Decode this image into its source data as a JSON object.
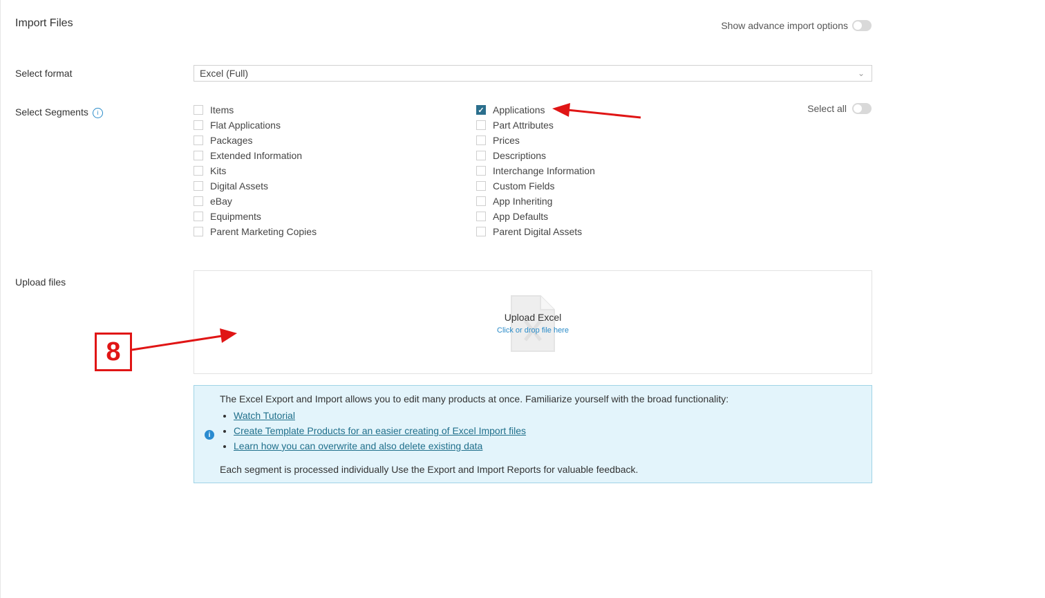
{
  "header": {
    "title": "Import Files",
    "advanced_label": "Show advance import options"
  },
  "format": {
    "label": "Select format",
    "value": "Excel (Full)"
  },
  "segments": {
    "label": "Select Segments",
    "select_all_label": "Select all",
    "left": [
      {
        "label": "Items",
        "checked": false
      },
      {
        "label": "Flat Applications",
        "checked": false
      },
      {
        "label": "Packages",
        "checked": false
      },
      {
        "label": "Extended Information",
        "checked": false
      },
      {
        "label": "Kits",
        "checked": false
      },
      {
        "label": "Digital Assets",
        "checked": false
      },
      {
        "label": "eBay",
        "checked": false
      },
      {
        "label": "Equipments",
        "checked": false
      },
      {
        "label": "Parent Marketing Copies",
        "checked": false
      }
    ],
    "right": [
      {
        "label": "Applications",
        "checked": true
      },
      {
        "label": "Part Attributes",
        "checked": false
      },
      {
        "label": "Prices",
        "checked": false
      },
      {
        "label": "Descriptions",
        "checked": false
      },
      {
        "label": "Interchange Information",
        "checked": false
      },
      {
        "label": "Custom Fields",
        "checked": false
      },
      {
        "label": "App Inheriting",
        "checked": false
      },
      {
        "label": "App Defaults",
        "checked": false
      },
      {
        "label": "Parent Digital Assets",
        "checked": false
      }
    ]
  },
  "upload": {
    "label": "Upload files",
    "title": "Upload Excel",
    "hint": "Click or drop file here"
  },
  "notice": {
    "intro": "The Excel Export and Import allows you to edit many products at once. Familiarize yourself with the broad functionality:",
    "links": [
      "Watch Tutorial",
      "Create Template Products for an easier creating of Excel Import files",
      "Learn how you can overwrite and also delete existing data"
    ],
    "outro": "Each segment is processed individually Use the Export and Import Reports for valuable feedback."
  },
  "annotation": {
    "step_number": "8",
    "color": "#e01515"
  },
  "colors": {
    "checkbox_checked": "#2b6f8d",
    "notice_bg": "#e3f4fb",
    "link": "#1f6f8b"
  }
}
